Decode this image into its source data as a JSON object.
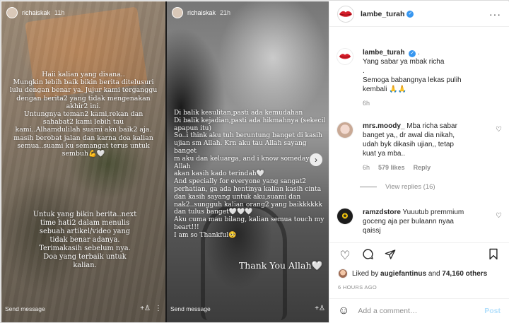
{
  "story1": {
    "username": "richaiskak",
    "time": "11h",
    "text_top": "Haii kalian yang disana..\nMungkin lebih baik bikin berita ditelusuri\nlulu dengan benar ya. Jujur kami terganggu\ndengan berita2 yang tidak mengenakan\nakhir2 ini.\nUntungnya teman2 kami,rekan dan\nsahabat2 kami lebih tau\nkami..Alhamdulilah suami aku baik2 aja.\nmasih berobat jalan dan karna doa kalian\nsemua..suami ku semangat terus untuk\nsembuh💪🤍",
    "text_bottom": "Untuk yang bikin berita..next\ntime hati2 dalam menulis\nsebuah artikel/video yang\ntidak benar adanya.\nTerimakasih sebelum nya.\nDoa yang terbaik untuk\nkalian.",
    "send_message": "Send message"
  },
  "story2": {
    "username": "richaiskak",
    "time": "21h",
    "text_main": "Di balik kesulitan,pasti ada kemudahan\nDi balik kejadian,pasti ada hikmahnya (sekecil\n apapun itu)\nSo..i think aku tuh beruntung banget di kasih\nujian sm Allah. Krn aku tau Allah sayang banget\nm aku dan keluarga, and i know someday Allah\nakan kasih kado terindah🤍\nAnd specially for everyone yang sangat2\nperhatian, ga ada hentinya kalian kasih cinta\ndan kasih sayang untuk aku,suami dan\nnak2..sungguh kalian orang2 yang baikkkkkk\ndan tulus banget🤍🤍🤍\nAku cuma mau bilang, kalian semua touch my\nheart!!!\nI am so Thankful🥺",
    "text_thanks": "Thank You Allah🤍",
    "send_message": "Send message"
  },
  "post": {
    "username": "lambe_turah",
    "more": "···"
  },
  "caption": {
    "username": "lambe_turah",
    "text": "Yang sabar ya mbak richa\n.\nSemoga babangnya lekas pulih\nkembali 🙏🙏",
    "time": "6h"
  },
  "comments": [
    {
      "username": "mrs.moody_",
      "text": "Mba richa sabar\nbanget ya,, dr awal dia nikah,\nudah byk dikasih ujian,, tetap\nkuat ya mba..",
      "time": "6h",
      "likes": "579 likes",
      "reply": "Reply",
      "view_replies": "View replies (16)"
    },
    {
      "username": "ramzdstore",
      "text": "Yuuutub premmium\ngoceng aja per bulaann nyaa\nqaissj"
    }
  ],
  "likes": {
    "prefix": "Liked by",
    "user": "augiefantinus",
    "and": "and",
    "others": "74,160 others"
  },
  "timestamp": "6 HOURS AGO",
  "add_comment": {
    "placeholder": "Add a comment…",
    "post_label": "Post"
  },
  "colors": {
    "link_blue": "#3897f0",
    "post_disabled": "#b2dffc",
    "secondary_text": "#8e8e8e"
  },
  "icons": [
    "heart-icon",
    "comment-icon",
    "share-icon",
    "bookmark-icon",
    "smile-icon",
    "verified-icon",
    "next-arrow-icon"
  ]
}
